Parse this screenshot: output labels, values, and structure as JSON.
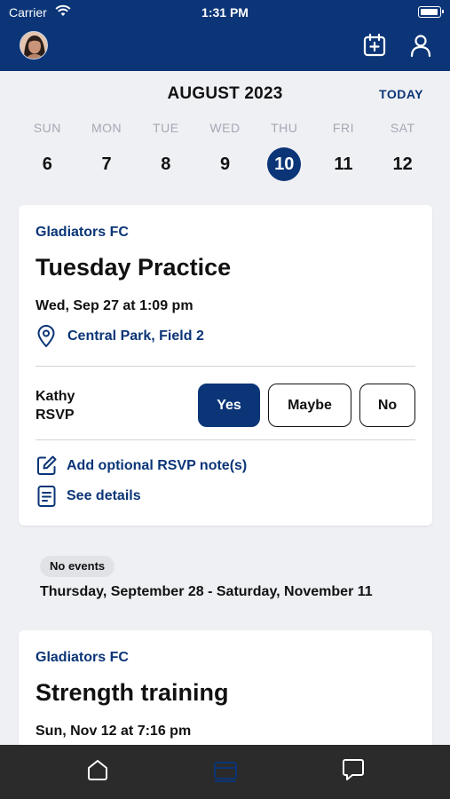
{
  "status_bar": {
    "carrier": "Carrier",
    "time": "1:31 PM"
  },
  "header": {
    "avatar": "avatar-photo",
    "icons": [
      "calendar-add-icon",
      "profile-icon"
    ]
  },
  "calendar": {
    "month": "AUGUST 2023",
    "today_label": "TODAY",
    "days": [
      {
        "dow": "SUN",
        "num": "6"
      },
      {
        "dow": "MON",
        "num": "7"
      },
      {
        "dow": "TUE",
        "num": "8"
      },
      {
        "dow": "WED",
        "num": "9"
      },
      {
        "dow": "THU",
        "num": "10",
        "selected": true
      },
      {
        "dow": "FRI",
        "num": "11"
      },
      {
        "dow": "SAT",
        "num": "12"
      }
    ]
  },
  "event1": {
    "team": "Gladiators FC",
    "title": "Tuesday Practice",
    "datetime": "Wed, Sep 27 at 1:09 pm",
    "location": "Central Park, Field 2",
    "rsvp_name": "Kathy",
    "rsvp_label": "RSVP",
    "buttons": {
      "yes": "Yes",
      "maybe": "Maybe",
      "no": "No"
    },
    "note_action": "Add optional RSVP note(s)",
    "details_action": "See details"
  },
  "gap": {
    "badge": "No events",
    "range": "Thursday, September 28 - Saturday, November 11"
  },
  "event2": {
    "team": "Gladiators FC",
    "title": "Strength training",
    "datetime": "Sun, Nov 12 at 7:16 pm"
  },
  "tabbar": {
    "tabs": [
      "home-icon",
      "schedule-icon",
      "chat-icon"
    ],
    "active_tab": "schedule-icon"
  },
  "colors": {
    "brand": "#0b3577",
    "background": "#eff0f4",
    "tabbar": "#2b2b2b"
  }
}
